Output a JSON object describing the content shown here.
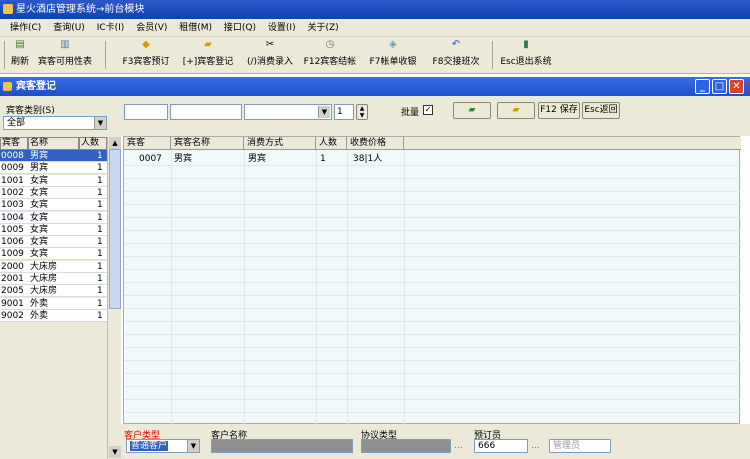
{
  "app": {
    "title": "星火酒店管理系统→前台模块"
  },
  "menu": [
    "操作(C)",
    "查询(U)",
    "IC卡(I)",
    "会员(V)",
    "租借(M)",
    "接口(Q)",
    "设置(I)",
    "关于(Z)"
  ],
  "toolbar": [
    {
      "label": "刷新",
      "icon": "refresh-icon"
    },
    {
      "label": "宾客可用性表",
      "icon": "table-icon"
    },
    {
      "label": "F3宾客预订",
      "icon": "reserve-icon"
    },
    {
      "label": "[+]宾客登记",
      "icon": "register-icon"
    },
    {
      "label": "(/)消费录入",
      "icon": "scissors-icon"
    },
    {
      "label": "F12宾客结帐",
      "icon": "clock-icon"
    },
    {
      "label": "F7帐单收银",
      "icon": "cash-icon"
    },
    {
      "label": "F8交接班次",
      "icon": "undo-icon"
    },
    {
      "label": "Esc退出系统",
      "icon": "exit-icon"
    }
  ],
  "window": {
    "title": "宾客登记"
  },
  "category": {
    "label": "宾客类别(S)",
    "value": "全部"
  },
  "left_table": {
    "headers": [
      "宾客",
      "名称",
      "人数"
    ],
    "rows": [
      {
        "code": "0008",
        "name": "男宾",
        "count": "1"
      },
      {
        "code": "0009",
        "name": "男宾",
        "count": "1"
      },
      {
        "code": "1001",
        "name": "女宾",
        "count": "1"
      },
      {
        "code": "1002",
        "name": "女宾",
        "count": "1"
      },
      {
        "code": "1003",
        "name": "女宾",
        "count": "1"
      },
      {
        "code": "1004",
        "name": "女宾",
        "count": "1"
      },
      {
        "code": "1005",
        "name": "女宾",
        "count": "1"
      },
      {
        "code": "1006",
        "name": "女宾",
        "count": "1"
      },
      {
        "code": "1009",
        "name": "女宾",
        "count": "1"
      },
      {
        "code": "2000",
        "name": "大床房",
        "count": "1"
      },
      {
        "code": "2001",
        "name": "大床房",
        "count": "1"
      },
      {
        "code": "2005",
        "name": "大床房",
        "count": "1"
      },
      {
        "code": "9001",
        "name": "外卖",
        "count": "1"
      },
      {
        "code": "9002",
        "name": "外卖",
        "count": "1"
      }
    ]
  },
  "form": {
    "qty": "1",
    "batch_label": "批量",
    "save": "F12 保存",
    "back": "Esc返回"
  },
  "grid": {
    "headers": [
      "宾客",
      "宾客名称",
      "消费方式",
      "人数",
      "收费价格"
    ],
    "rows": [
      {
        "guest": "0007",
        "name": "男宾",
        "method": "男宾",
        "count": "1",
        "price": "38|1人"
      }
    ]
  },
  "bottom": {
    "customer_type_label": "客户类型",
    "customer_type_value": "普通客户",
    "customer_name_label": "客户名称",
    "agreement_label": "协议类型",
    "booker_label": "预订员",
    "booker_value": "666",
    "manager_placeholder": "管理员",
    "ellipsis": "..."
  },
  "colors": {
    "titlebar": "#1d4fc8",
    "selected_row": "#3161c5",
    "grid_bg": "#f0f8f8",
    "panel": "#ece9d8",
    "red_label": "#e00000"
  }
}
